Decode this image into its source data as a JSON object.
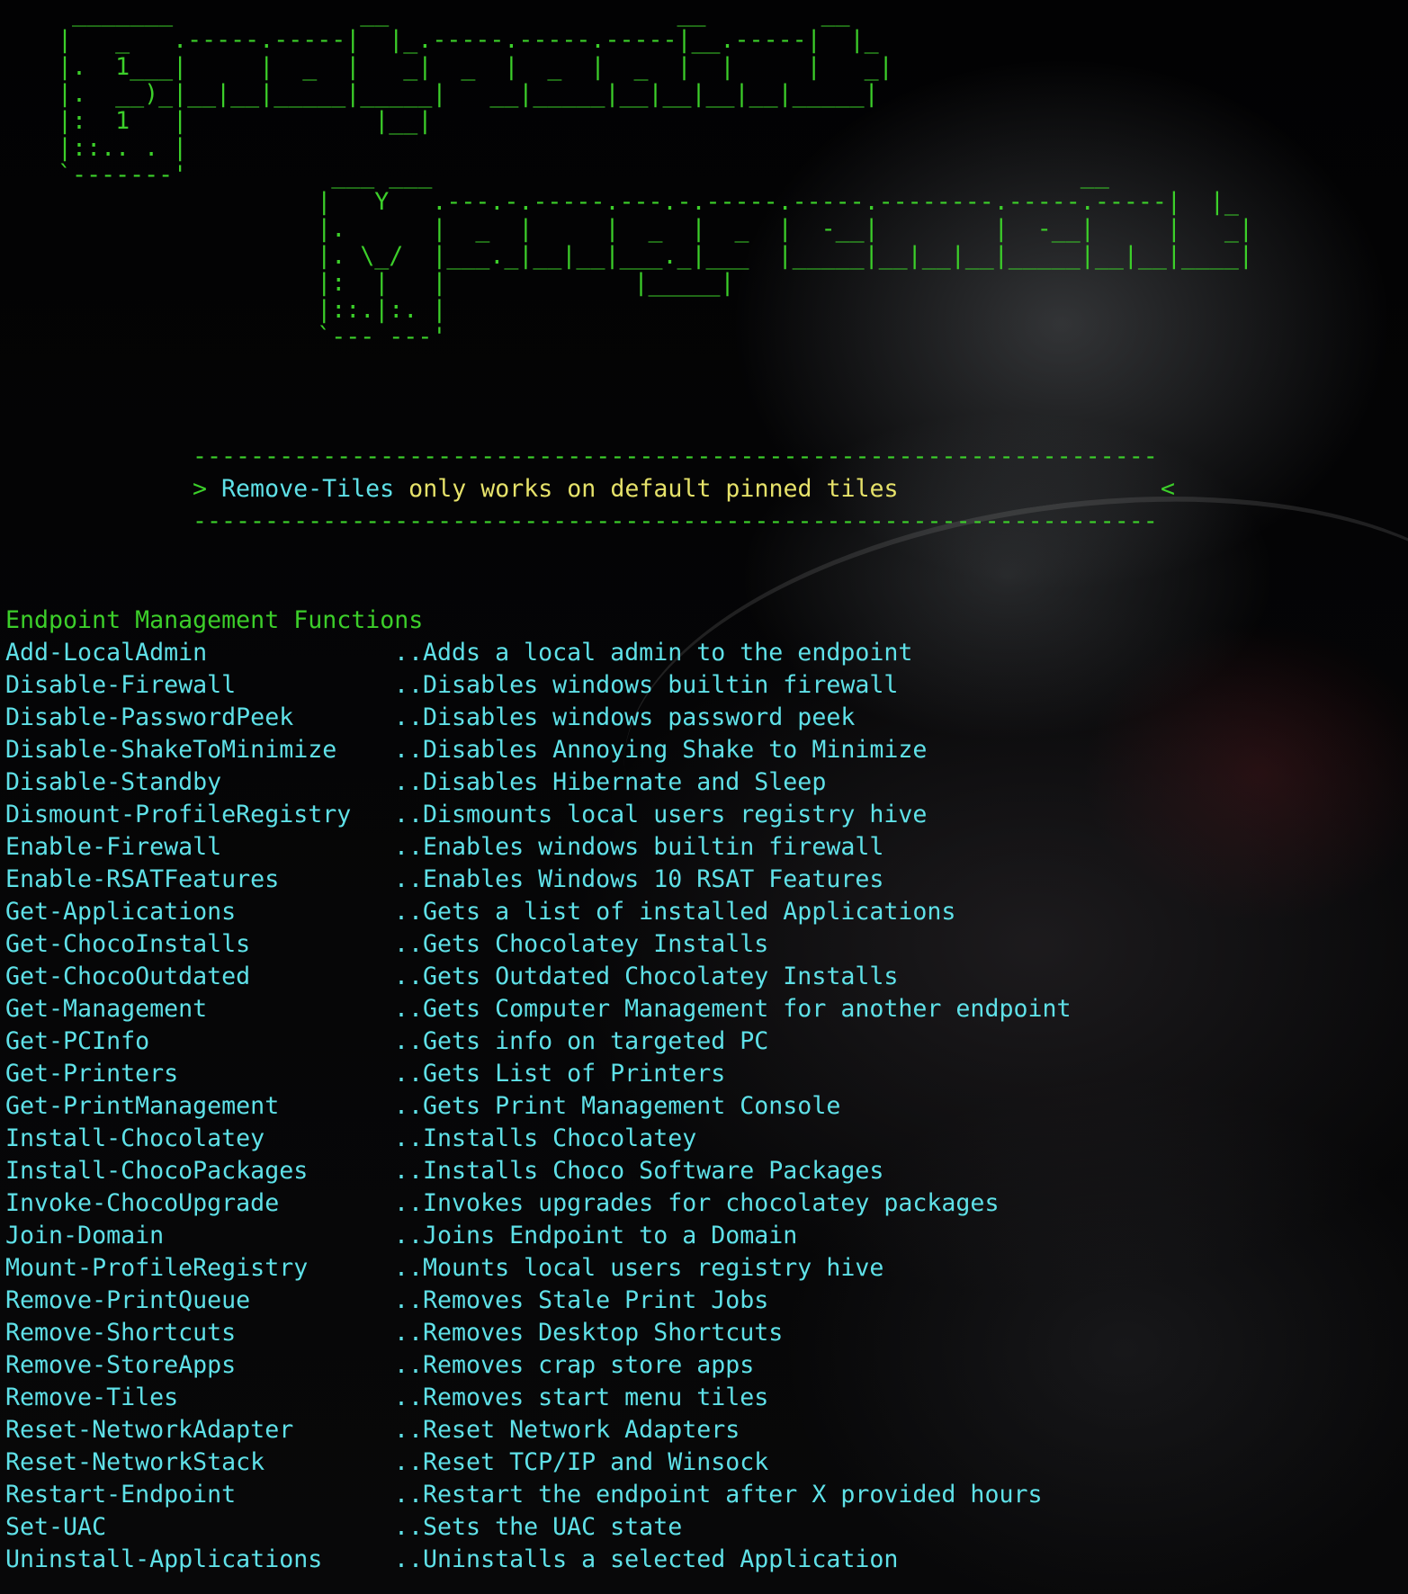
{
  "banner": {
    "ascii_art": "     _______             __                    __        __\n    |   _   .-----.-----|  |_.-----.-----.-----|__.-----|  |_\n    |.  1___|     |  _  |   _|  _  |  _  |  _  |  |     |   _|\n    |.  __)_|__|__|_____|_____|   __|_____|__|__|__|__|_____|\n    |:  1   |             |__|\n    |::.. . |\n    `-------'          ___ ___                                             __\n                      |   Y   .---.-.-----.---.-.-----.-----.--------.-----.-----|  |_\n                      |.      |  _  |     |  _  |  _  |  -__|        |  -__|     |   _|\n                      |. \\_/  |___._|__|__|___._|___  |_____|__|__|__|_____|__|__|____|\n                      |:  |   |             |_____|\n                      |::.|:. |\n                      `--- ---'",
    "color": "#3ccf2a"
  },
  "notice": {
    "rule": "-------------------------------------------------------------------",
    "arrow_left": "> ",
    "command": "Remove-Tiles",
    "text": " only works on default pinned tiles",
    "arrow_right": "<"
  },
  "section_title": "Endpoint Management Functions",
  "functions": [
    {
      "name": "Add-LocalAdmin",
      "desc": "..Adds a local admin to the endpoint"
    },
    {
      "name": "Disable-Firewall",
      "desc": "..Disables windows builtin firewall"
    },
    {
      "name": "Disable-PasswordPeek",
      "desc": "..Disables windows password peek"
    },
    {
      "name": "Disable-ShakeToMinimize",
      "desc": "..Disables Annoying Shake to Minimize"
    },
    {
      "name": "Disable-Standby",
      "desc": "..Disables Hibernate and Sleep"
    },
    {
      "name": "Dismount-ProfileRegistry",
      "desc": "..Dismounts local users registry hive"
    },
    {
      "name": "Enable-Firewall",
      "desc": "..Enables windows builtin firewall"
    },
    {
      "name": "Enable-RSATFeatures",
      "desc": "..Enables Windows 10 RSAT Features"
    },
    {
      "name": "Get-Applications",
      "desc": "..Gets a list of installed Applications"
    },
    {
      "name": "Get-ChocoInstalls",
      "desc": "..Gets Chocolatey Installs"
    },
    {
      "name": "Get-ChocoOutdated",
      "desc": "..Gets Outdated Chocolatey Installs"
    },
    {
      "name": "Get-Management",
      "desc": "..Gets Computer Management for another endpoint"
    },
    {
      "name": "Get-PCInfo",
      "desc": "..Gets info on targeted PC"
    },
    {
      "name": "Get-Printers",
      "desc": "..Gets List of Printers"
    },
    {
      "name": "Get-PrintManagement",
      "desc": "..Gets Print Management Console"
    },
    {
      "name": "Install-Chocolatey",
      "desc": "..Installs Chocolatey"
    },
    {
      "name": "Install-ChocoPackages",
      "desc": "..Installs Choco Software Packages"
    },
    {
      "name": "Invoke-ChocoUpgrade",
      "desc": "..Invokes upgrades for chocolatey packages"
    },
    {
      "name": "Join-Domain",
      "desc": "..Joins Endpoint to a Domain"
    },
    {
      "name": "Mount-ProfileRegistry",
      "desc": "..Mounts local users registry hive"
    },
    {
      "name": "Remove-PrintQueue",
      "desc": "..Removes Stale Print Jobs"
    },
    {
      "name": "Remove-Shortcuts",
      "desc": "..Removes Desktop Shortcuts"
    },
    {
      "name": "Remove-StoreApps",
      "desc": "..Removes crap store apps"
    },
    {
      "name": "Remove-Tiles",
      "desc": "..Removes start menu tiles"
    },
    {
      "name": "Reset-NetworkAdapter",
      "desc": "..Reset Network Adapters"
    },
    {
      "name": "Reset-NetworkStack",
      "desc": "..Reset TCP/IP and Winsock"
    },
    {
      "name": "Restart-Endpoint",
      "desc": "..Restart the endpoint after X provided hours"
    },
    {
      "name": "Set-UAC",
      "desc": "..Sets the UAC state"
    },
    {
      "name": "Uninstall-Applications",
      "desc": "..Uninstalls a selected Application"
    }
  ],
  "colors": {
    "green": "#3ccf2a",
    "cyan": "#5fe1e8",
    "yellow": "#e6e26a",
    "background": "#000000"
  }
}
